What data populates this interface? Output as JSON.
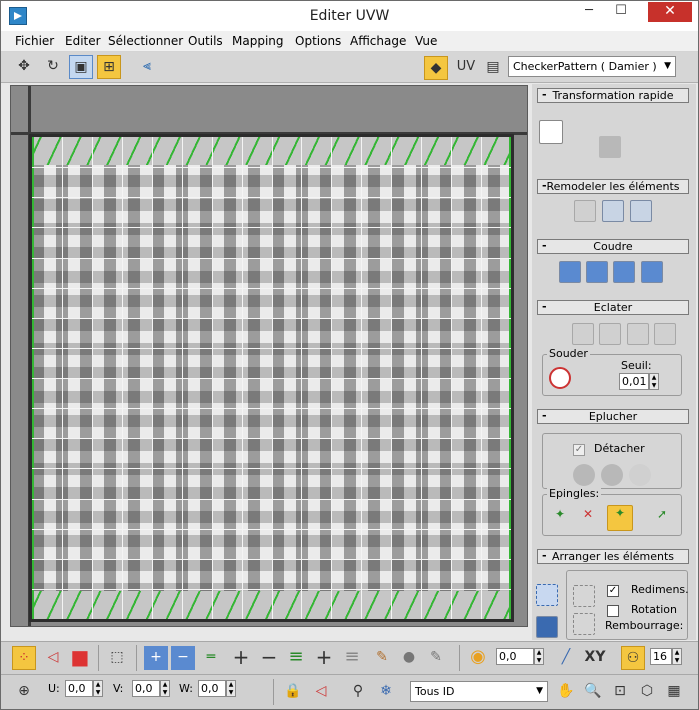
{
  "window": {
    "title": "Editer UVW",
    "minimize": "─",
    "maximize": "☐",
    "close": "✕"
  },
  "menu": [
    "Fichier",
    "Editer",
    "Sélectionner",
    "Outils",
    "Mapping",
    "Options",
    "Affichage",
    "Vue"
  ],
  "toolbar": {
    "uv_label": "UV",
    "texture_dropdown": "CheckerPattern  ( Damier )"
  },
  "panel": {
    "quick_transform": "Transformation rapide",
    "reshape": "Remodeler les éléments",
    "stitch": "Coudre",
    "explode": "Eclater",
    "weld_group": "Souder",
    "threshold_label": "Seuil:",
    "threshold_value": "0,01",
    "peel": "Eplucher",
    "detach_label": "Détacher",
    "pins_group": "Epingles:",
    "arrange": "Arranger les éléments",
    "rescale_label": "Redimens.",
    "rotation_label": "Rotation",
    "padding_label": "Rembourrage:"
  },
  "bottom": {
    "soft_value": "0,0",
    "xy_label": "XY",
    "grid_value": "16",
    "u_label": "U:",
    "u_value": "0,0",
    "v_label": "V:",
    "v_value": "0,0",
    "w_label": "W:",
    "w_value": "0,0",
    "id_dropdown": "Tous ID"
  },
  "colors": {
    "accent": "#f4c640",
    "selection_edge": "#35b635",
    "close": "#c7312b"
  }
}
